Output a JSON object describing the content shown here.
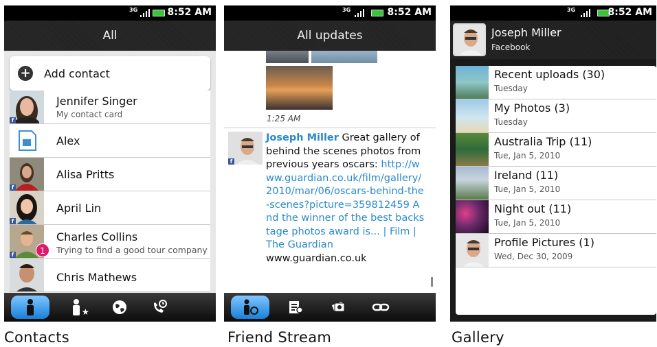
{
  "status": {
    "network": "3G",
    "time": "8:52 AM"
  },
  "colors": {
    "facebook": "#3b5998",
    "link": "#2a8acc",
    "badge": "#e0186c",
    "tab_active": "#1a7fd8"
  },
  "contacts_screen": {
    "title": "All",
    "add_contact_label": "Add contact",
    "contacts": [
      {
        "name": "Jennifer Singer",
        "subtitle": "My contact card",
        "facebook": true
      },
      {
        "name": "Alex",
        "subtitle": "",
        "facebook": false,
        "icon": "sim-card-icon"
      },
      {
        "name": "Alisa Pritts",
        "subtitle": "",
        "facebook": true
      },
      {
        "name": "April Lin",
        "subtitle": "",
        "facebook": true
      },
      {
        "name": "Charles  Collins",
        "subtitle": "Trying to find a good tour company",
        "facebook": true,
        "badge": "1"
      },
      {
        "name": "Chris Mathews",
        "subtitle": "",
        "facebook": false
      }
    ],
    "tabs": [
      "person-icon",
      "group-icon",
      "globe-icon",
      "call-history-icon"
    ],
    "caption": "Contacts"
  },
  "stream_screen": {
    "title": "All updates",
    "time": "1:25 AM",
    "post": {
      "author": "Joseph Miller",
      "text_before": " Great gallery of behind the scenes photos from previous years oscars: ",
      "link": "http://www.guardian.co.uk/film/gallery/2010/mar/06/oscars-behind-the-scenes?picture=359812459 And the winner of the best backstage photos award is... | Film | The Guardian",
      "domain": "www.guardian.co.uk"
    },
    "tabs": [
      "friend-stream-icon",
      "status-update-icon",
      "photo-upload-icon",
      "link-icon"
    ],
    "caption": "Friend Stream"
  },
  "gallery_screen": {
    "user_name": "Joseph Miller",
    "user_source": "Facebook",
    "albums": [
      {
        "title": "Recent uploads",
        "count": "(30)",
        "date": "Tuesday"
      },
      {
        "title": "My Photos",
        "count": "(3)",
        "date": "Tuesday"
      },
      {
        "title": "Australia Trip",
        "count": "(11)",
        "date": "Tue, Jan 5, 2010"
      },
      {
        "title": "Ireland",
        "count": "(11)",
        "date": "Tue, Jan 5, 2010"
      },
      {
        "title": "Night out",
        "count": "(11)",
        "date": "Tue, Jan 5, 2010"
      },
      {
        "title": "Profile Pictures",
        "count": "(1)",
        "date": "Wed, Dec 30, 2009"
      }
    ],
    "caption": "Gallery"
  }
}
